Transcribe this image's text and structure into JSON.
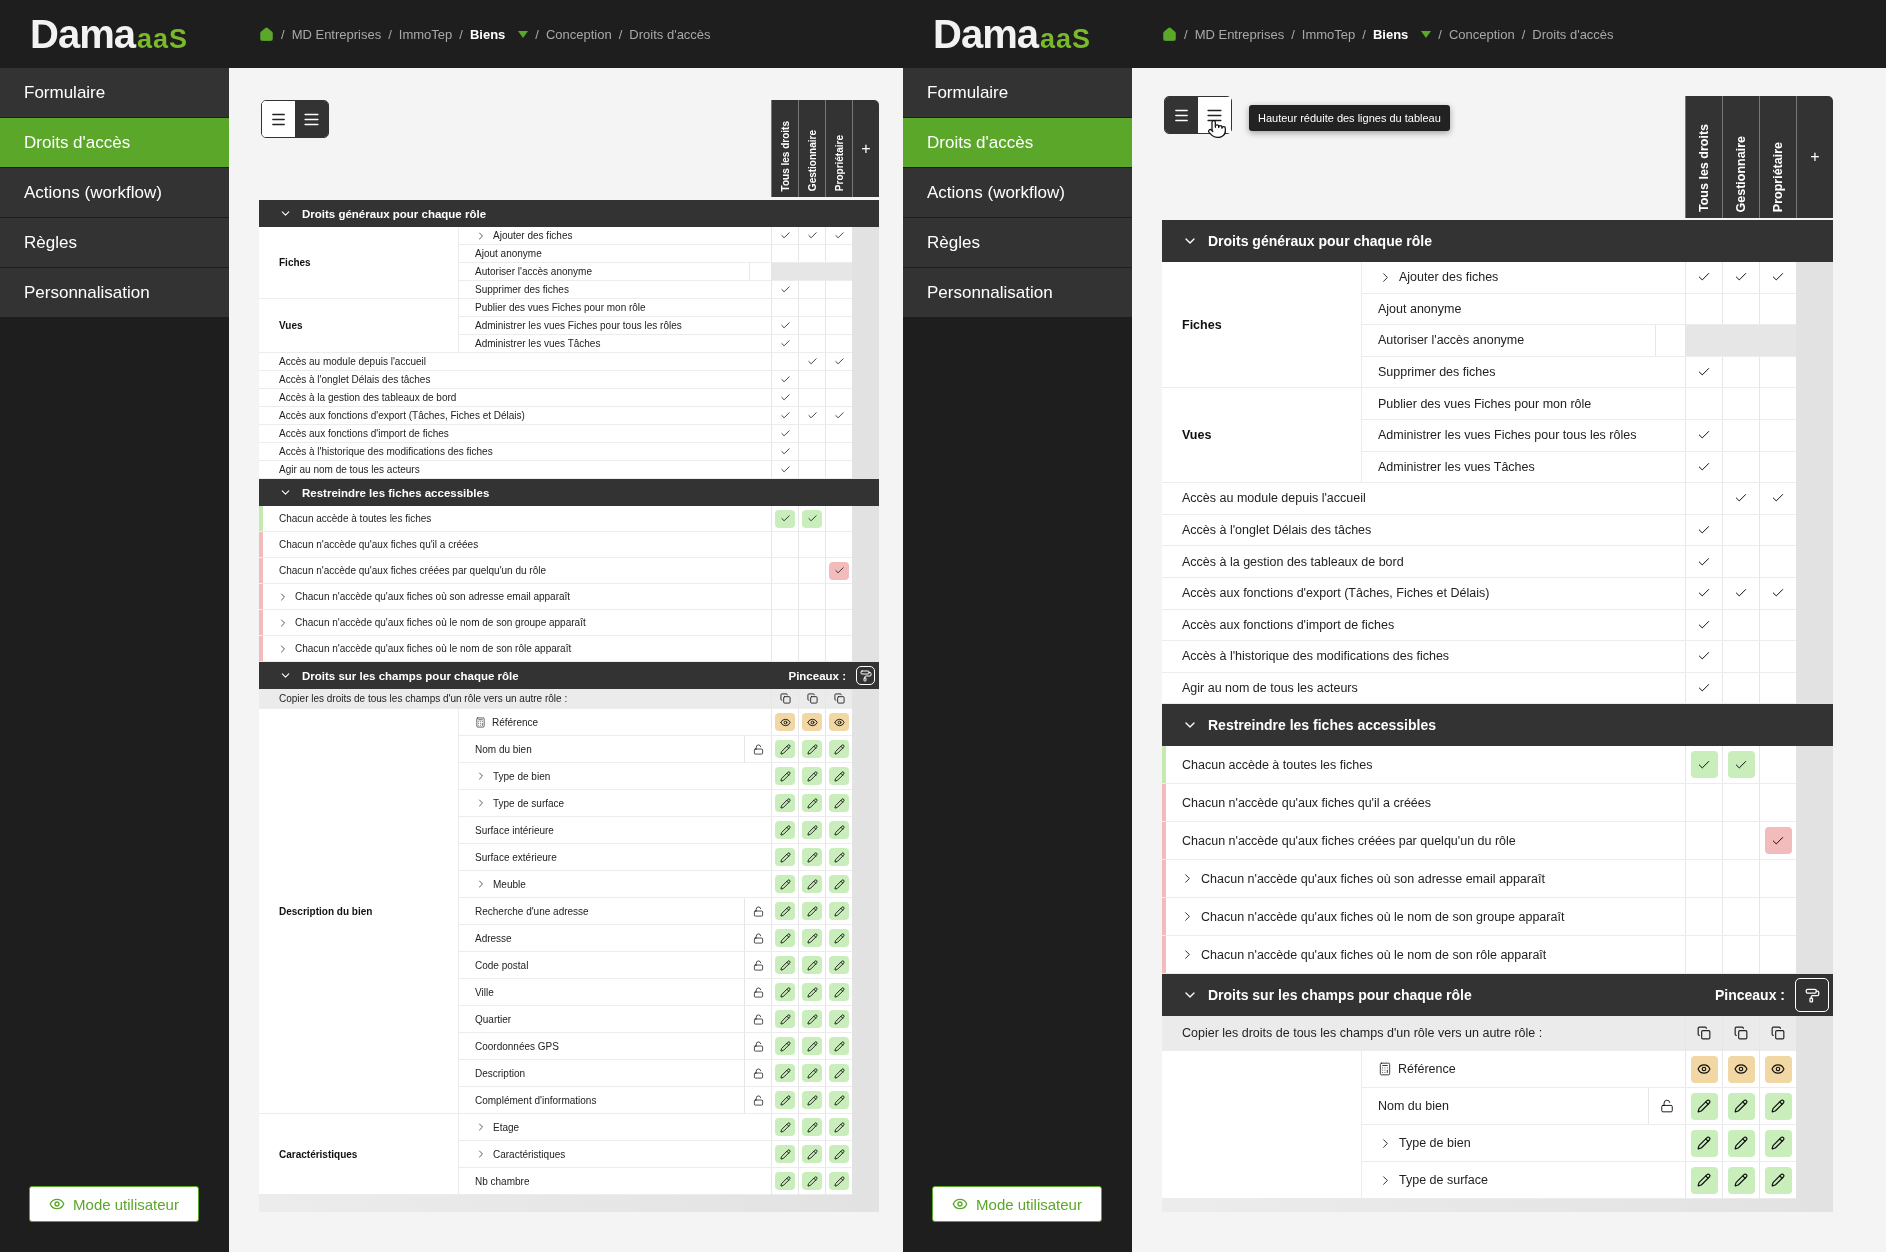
{
  "panels": [
    {
      "logo": {
        "text": "Dama",
        "suffix": "aaS"
      },
      "breadcrumb": {
        "separator": "/",
        "items": [
          {
            "label": "MD Entreprises",
            "active": false,
            "dropdown": false
          },
          {
            "label": "ImmoTep",
            "active": false,
            "dropdown": false
          },
          {
            "label": "Biens",
            "active": true,
            "dropdown": true
          },
          {
            "label": "Conception",
            "active": false,
            "dropdown": false
          },
          {
            "label": "Droits d'accès",
            "active": false,
            "dropdown": false
          }
        ]
      },
      "nav": [
        {
          "label": "Formulaire",
          "selected": false
        },
        {
          "label": "Droits d'accès",
          "selected": true
        },
        {
          "label": "Actions (workflow)",
          "selected": false
        },
        {
          "label": "Règles",
          "selected": false
        },
        {
          "label": "Personnalisation",
          "selected": false
        }
      ],
      "user_mode": "Mode utilisateur",
      "density": [
        {
          "kind": "normal",
          "selected": false
        },
        {
          "kind": "compact",
          "selected": true
        }
      ],
      "roles": [
        "Tous les droits",
        "Gestionnaire",
        "Propriétaire"
      ],
      "add_role": "+",
      "general": {
        "title": "Droits généraux pour chaque rôle",
        "rows": [
          {
            "kind": "group",
            "label": "Fiches",
            "rows": [
              {
                "label": "Ajouter des fiches",
                "expandable": true,
                "disabled": false,
                "checks": [
                  true,
                  true,
                  true
                ]
              },
              {
                "label": "Ajout anonyme",
                "expandable": false,
                "disabled": false,
                "checks": [
                  false,
                  false,
                  false
                ]
              },
              {
                "label": "Autoriser l'accès anonyme",
                "expandable": false,
                "disabled": true,
                "checks": [
                  false,
                  false,
                  false
                ]
              },
              {
                "label": "Supprimer des fiches",
                "expandable": false,
                "disabled": false,
                "checks": [
                  true,
                  false,
                  false
                ]
              }
            ]
          },
          {
            "kind": "group",
            "label": "Vues",
            "rows": [
              {
                "label": "Publier des vues Fiches pour mon rôle",
                "expandable": false,
                "disabled": false,
                "checks": [
                  false,
                  false,
                  false
                ]
              },
              {
                "label": "Administrer les vues Fiches pour tous les rôles",
                "expandable": false,
                "disabled": false,
                "checks": [
                  true,
                  false,
                  false
                ]
              },
              {
                "label": "Administrer les vues Tâches",
                "expandable": false,
                "disabled": false,
                "checks": [
                  true,
                  false,
                  false
                ]
              }
            ]
          },
          {
            "kind": "row",
            "label": "Accès au module depuis l'accueil",
            "expandable": false,
            "disabled": false,
            "checks": [
              false,
              true,
              true
            ]
          },
          {
            "kind": "row",
            "label": "Accès à l'onglet Délais des tâches",
            "expandable": false,
            "disabled": false,
            "checks": [
              true,
              false,
              false
            ]
          },
          {
            "kind": "row",
            "label": "Accès à la gestion des tableaux de bord",
            "expandable": false,
            "disabled": false,
            "checks": [
              true,
              false,
              false
            ]
          },
          {
            "kind": "row",
            "label": "Accès aux fonctions d'export (Tâches, Fiches et Délais)",
            "expandable": false,
            "disabled": false,
            "checks": [
              true,
              true,
              true
            ]
          },
          {
            "kind": "row",
            "label": "Accès aux fonctions d'import de fiches",
            "expandable": false,
            "disabled": false,
            "checks": [
              true,
              false,
              false
            ]
          },
          {
            "kind": "row",
            "label": "Accès à l'historique des modifications des fiches",
            "expandable": false,
            "disabled": false,
            "checks": [
              true,
              false,
              false
            ]
          },
          {
            "kind": "row",
            "label": "Agir au nom de tous les acteurs",
            "expandable": false,
            "disabled": false,
            "checks": [
              true,
              false,
              false
            ]
          }
        ]
      },
      "restrict": {
        "title": "Restreindre les fiches accessibles",
        "rows": [
          {
            "label": "Chacun accède à toutes les fiches",
            "expandable": false,
            "allowed": true,
            "checks": [
              true,
              true,
              false
            ]
          },
          {
            "label": "Chacun n'accède qu'aux fiches qu'il a créées",
            "expandable": false,
            "allowed": false,
            "checks": [
              false,
              false,
              false
            ]
          },
          {
            "label": "Chacun n'accède qu'aux fiches créées par quelqu'un du rôle",
            "expandable": false,
            "allowed": false,
            "checks": [
              false,
              false,
              true
            ]
          },
          {
            "label": "Chacun n'accède qu'aux fiches où son adresse email apparaît",
            "expandable": true,
            "allowed": false,
            "checks": [
              false,
              false,
              false
            ]
          },
          {
            "label": "Chacun n'accède qu'aux fiches où le nom de son groupe apparaît",
            "expandable": true,
            "allowed": false,
            "checks": [
              false,
              false,
              false
            ]
          },
          {
            "label": "Chacun n'accède qu'aux fiches où le nom de son rôle apparaît",
            "expandable": true,
            "allowed": false,
            "checks": [
              false,
              false,
              false
            ]
          }
        ]
      },
      "fields": {
        "title": "Droits sur les champs pour chaque rôle",
        "brush_label": "Pinceaux :",
        "copy_label": "Copier les droits de tous les champs d'un rôle vers un autre rôle :",
        "groups": [
          {
            "label": "Description du bien",
            "fields": [
              {
                "label": "Référence",
                "expandable": false,
                "computed": true,
                "lockable": false,
                "rights": [
                  {
                    "kind": "read"
                  },
                  {
                    "kind": "read"
                  },
                  {
                    "kind": "read"
                  }
                ]
              },
              {
                "label": "Nom du bien",
                "expandable": false,
                "computed": false,
                "lockable": true,
                "rights": [
                  {
                    "kind": "edit"
                  },
                  {
                    "kind": "edit"
                  },
                  {
                    "kind": "edit"
                  }
                ]
              },
              {
                "label": "Type de bien",
                "expandable": true,
                "computed": false,
                "lockable": false,
                "rights": [
                  {
                    "kind": "edit"
                  },
                  {
                    "kind": "edit"
                  },
                  {
                    "kind": "edit"
                  }
                ]
              },
              {
                "label": "Type de surface",
                "expandable": true,
                "computed": false,
                "lockable": false,
                "rights": [
                  {
                    "kind": "edit"
                  },
                  {
                    "kind": "edit"
                  },
                  {
                    "kind": "edit"
                  }
                ]
              },
              {
                "label": "Surface intérieure",
                "expandable": false,
                "computed": false,
                "lockable": false,
                "rights": [
                  {
                    "kind": "edit"
                  },
                  {
                    "kind": "edit"
                  },
                  {
                    "kind": "edit"
                  }
                ]
              },
              {
                "label": "Surface extérieure",
                "expandable": false,
                "computed": false,
                "lockable": false,
                "rights": [
                  {
                    "kind": "edit"
                  },
                  {
                    "kind": "edit"
                  },
                  {
                    "kind": "edit"
                  }
                ]
              },
              {
                "label": "Meuble",
                "expandable": true,
                "computed": false,
                "lockable": false,
                "rights": [
                  {
                    "kind": "edit"
                  },
                  {
                    "kind": "edit"
                  },
                  {
                    "kind": "edit"
                  }
                ]
              },
              {
                "label": "Recherche d'une adresse",
                "expandable": false,
                "computed": false,
                "lockable": true,
                "rights": [
                  {
                    "kind": "edit"
                  },
                  {
                    "kind": "edit"
                  },
                  {
                    "kind": "edit"
                  }
                ]
              },
              {
                "label": "Adresse",
                "expandable": false,
                "computed": false,
                "lockable": true,
                "rights": [
                  {
                    "kind": "edit"
                  },
                  {
                    "kind": "edit"
                  },
                  {
                    "kind": "edit"
                  }
                ]
              },
              {
                "label": "Code postal",
                "expandable": false,
                "computed": false,
                "lockable": true,
                "rights": [
                  {
                    "kind": "edit"
                  },
                  {
                    "kind": "edit"
                  },
                  {
                    "kind": "edit"
                  }
                ]
              },
              {
                "label": "Ville",
                "expandable": false,
                "computed": false,
                "lockable": true,
                "rights": [
                  {
                    "kind": "edit"
                  },
                  {
                    "kind": "edit"
                  },
                  {
                    "kind": "edit"
                  }
                ]
              },
              {
                "label": "Quartier",
                "expandable": false,
                "computed": false,
                "lockable": true,
                "rights": [
                  {
                    "kind": "edit"
                  },
                  {
                    "kind": "edit"
                  },
                  {
                    "kind": "edit"
                  }
                ]
              },
              {
                "label": "Coordonnées GPS",
                "expandable": false,
                "computed": false,
                "lockable": true,
                "rights": [
                  {
                    "kind": "edit"
                  },
                  {
                    "kind": "edit"
                  },
                  {
                    "kind": "edit"
                  }
                ]
              },
              {
                "label": "Description",
                "expandable": false,
                "computed": false,
                "lockable": true,
                "rights": [
                  {
                    "kind": "edit"
                  },
                  {
                    "kind": "edit"
                  },
                  {
                    "kind": "edit"
                  }
                ]
              },
              {
                "label": "Complément d'informations",
                "expandable": false,
                "computed": false,
                "lockable": true,
                "rights": [
                  {
                    "kind": "edit"
                  },
                  {
                    "kind": "edit"
                  },
                  {
                    "kind": "edit"
                  }
                ]
              }
            ]
          },
          {
            "label": "Caractéristiques",
            "fields": [
              {
                "label": "Etage",
                "expandable": true,
                "computed": false,
                "lockable": false,
                "rights": [
                  {
                    "kind": "edit"
                  },
                  {
                    "kind": "edit"
                  },
                  {
                    "kind": "edit"
                  }
                ]
              },
              {
                "label": "Caractéristiques",
                "expandable": true,
                "computed": false,
                "lockable": false,
                "rights": [
                  {
                    "kind": "edit"
                  },
                  {
                    "kind": "edit"
                  },
                  {
                    "kind": "edit"
                  }
                ]
              },
              {
                "label": "Nb chambre",
                "expandable": false,
                "computed": false,
                "lockable": false,
                "rights": [
                  {
                    "kind": "edit"
                  },
                  {
                    "kind": "edit"
                  },
                  {
                    "kind": "edit"
                  }
                ]
              }
            ]
          }
        ]
      }
    },
    {
      "logo": {
        "text": "Dama",
        "suffix": "aaS"
      },
      "breadcrumb": {
        "separator": "/",
        "items": [
          {
            "label": "MD Entreprises",
            "active": false,
            "dropdown": false
          },
          {
            "label": "ImmoTep",
            "active": false,
            "dropdown": false
          },
          {
            "label": "Biens",
            "active": true,
            "dropdown": true
          },
          {
            "label": "Conception",
            "active": false,
            "dropdown": false
          },
          {
            "label": "Droits d'accès",
            "active": false,
            "dropdown": false
          }
        ]
      },
      "nav": [
        {
          "label": "Formulaire",
          "selected": false
        },
        {
          "label": "Droits d'accès",
          "selected": true
        },
        {
          "label": "Actions (workflow)",
          "selected": false
        },
        {
          "label": "Règles",
          "selected": false
        },
        {
          "label": "Personnalisation",
          "selected": false
        }
      ],
      "user_mode": "Mode utilisateur",
      "density": [
        {
          "kind": "normal",
          "selected": true
        },
        {
          "kind": "compact",
          "selected": false
        }
      ],
      "tooltip": "Hauteur réduite des lignes du tableau",
      "roles": [
        "Tous les droits",
        "Gestionnaire",
        "Propriétaire"
      ],
      "add_role": "+",
      "general": {
        "title": "Droits généraux pour chaque rôle",
        "rows": [
          {
            "kind": "group",
            "label": "Fiches",
            "rows": [
              {
                "label": "Ajouter des fiches",
                "expandable": true,
                "disabled": false,
                "checks": [
                  true,
                  true,
                  true
                ]
              },
              {
                "label": "Ajout anonyme",
                "expandable": false,
                "disabled": false,
                "checks": [
                  false,
                  false,
                  false
                ]
              },
              {
                "label": "Autoriser l'accès anonyme",
                "expandable": false,
                "disabled": true,
                "checks": [
                  false,
                  false,
                  false
                ]
              },
              {
                "label": "Supprimer des fiches",
                "expandable": false,
                "disabled": false,
                "checks": [
                  true,
                  false,
                  false
                ]
              }
            ]
          },
          {
            "kind": "group",
            "label": "Vues",
            "rows": [
              {
                "label": "Publier des vues Fiches pour mon rôle",
                "expandable": false,
                "disabled": false,
                "checks": [
                  false,
                  false,
                  false
                ]
              },
              {
                "label": "Administrer les vues Fiches pour tous les rôles",
                "expandable": false,
                "disabled": false,
                "checks": [
                  true,
                  false,
                  false
                ]
              },
              {
                "label": "Administrer les vues Tâches",
                "expandable": false,
                "disabled": false,
                "checks": [
                  true,
                  false,
                  false
                ]
              }
            ]
          },
          {
            "kind": "row",
            "label": "Accès au module depuis l'accueil",
            "expandable": false,
            "disabled": false,
            "checks": [
              false,
              true,
              true
            ]
          },
          {
            "kind": "row",
            "label": "Accès à l'onglet Délais des tâches",
            "expandable": false,
            "disabled": false,
            "checks": [
              true,
              false,
              false
            ]
          },
          {
            "kind": "row",
            "label": "Accès à la gestion des tableaux de bord",
            "expandable": false,
            "disabled": false,
            "checks": [
              true,
              false,
              false
            ]
          },
          {
            "kind": "row",
            "label": "Accès aux fonctions d'export (Tâches, Fiches et Délais)",
            "expandable": false,
            "disabled": false,
            "checks": [
              true,
              true,
              true
            ]
          },
          {
            "kind": "row",
            "label": "Accès aux fonctions d'import de fiches",
            "expandable": false,
            "disabled": false,
            "checks": [
              true,
              false,
              false
            ]
          },
          {
            "kind": "row",
            "label": "Accès à l'historique des modifications des fiches",
            "expandable": false,
            "disabled": false,
            "checks": [
              true,
              false,
              false
            ]
          },
          {
            "kind": "row",
            "label": "Agir au nom de tous les acteurs",
            "expandable": false,
            "disabled": false,
            "checks": [
              true,
              false,
              false
            ]
          }
        ]
      },
      "restrict": {
        "title": "Restreindre les fiches accessibles",
        "rows": [
          {
            "label": "Chacun accède à toutes les fiches",
            "expandable": false,
            "allowed": true,
            "checks": [
              true,
              true,
              false
            ]
          },
          {
            "label": "Chacun n'accède qu'aux fiches qu'il a créées",
            "expandable": false,
            "allowed": false,
            "checks": [
              false,
              false,
              false
            ]
          },
          {
            "label": "Chacun n'accède qu'aux fiches créées par quelqu'un du rôle",
            "expandable": false,
            "allowed": false,
            "checks": [
              false,
              false,
              true
            ]
          },
          {
            "label": "Chacun n'accède qu'aux fiches où son adresse email apparaît",
            "expandable": true,
            "allowed": false,
            "checks": [
              false,
              false,
              false
            ]
          },
          {
            "label": "Chacun n'accède qu'aux fiches où le nom de son groupe apparaît",
            "expandable": true,
            "allowed": false,
            "checks": [
              false,
              false,
              false
            ]
          },
          {
            "label": "Chacun n'accède qu'aux fiches où le nom de son rôle apparaît",
            "expandable": true,
            "allowed": false,
            "checks": [
              false,
              false,
              false
            ]
          }
        ]
      },
      "fields": {
        "title": "Droits sur les champs pour chaque rôle",
        "brush_label": "Pinceaux :",
        "copy_label": "Copier les droits de tous les champs d'un rôle vers un autre rôle :",
        "groups": [
          {
            "fields": [
              {
                "label": "Référence",
                "expandable": false,
                "computed": true,
                "lockable": false,
                "rights": [
                  {
                    "kind": "read"
                  },
                  {
                    "kind": "read"
                  },
                  {
                    "kind": "read"
                  }
                ]
              },
              {
                "label": "Nom du bien",
                "expandable": false,
                "computed": false,
                "lockable": true,
                "rights": [
                  {
                    "kind": "edit"
                  },
                  {
                    "kind": "edit"
                  },
                  {
                    "kind": "edit"
                  }
                ]
              },
              {
                "label": "Type de bien",
                "expandable": true,
                "computed": false,
                "lockable": false,
                "rights": [
                  {
                    "kind": "edit"
                  },
                  {
                    "kind": "edit"
                  },
                  {
                    "kind": "edit"
                  }
                ]
              },
              {
                "label": "Type de surface",
                "expandable": true,
                "computed": false,
                "lockable": false,
                "rights": [
                  {
                    "kind": "edit"
                  },
                  {
                    "kind": "edit"
                  },
                  {
                    "kind": "edit"
                  }
                ]
              }
            ]
          }
        ]
      }
    }
  ]
}
